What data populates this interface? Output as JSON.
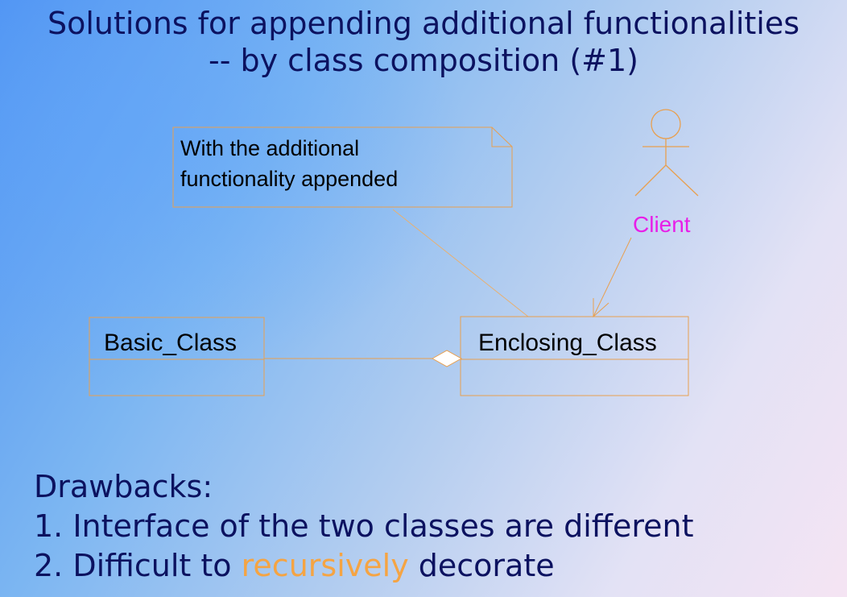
{
  "title": {
    "line1": "Solutions for appending additional functionalities",
    "line2": "-- by class composition (#1)"
  },
  "diagram": {
    "note": {
      "line1": "With the additional",
      "line2": "functionality appended"
    },
    "actor": {
      "label": "Client",
      "label_color": "#e81ee8"
    },
    "classes": {
      "basic": "Basic_Class",
      "enclosing": "Enclosing_Class"
    },
    "line_color": "#e8a050"
  },
  "drawbacks": {
    "heading": "Drawbacks:",
    "item1": "1. Interface of the two classes are different",
    "item2_prefix": "2. Difficult to ",
    "item2_highlight": "recursively",
    "item2_suffix": " decorate",
    "highlight_color": "#f5a443"
  },
  "colors": {
    "title_text": "#0c1260"
  }
}
